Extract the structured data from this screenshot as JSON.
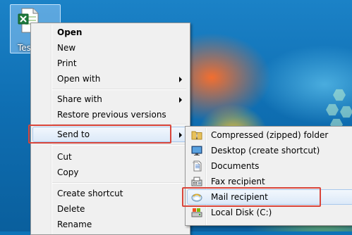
{
  "desktop": {
    "file": {
      "label": "Test"
    }
  },
  "context_menu": {
    "items": [
      {
        "label": "Open",
        "bold": true
      },
      {
        "label": "New"
      },
      {
        "label": "Print"
      },
      {
        "label": "Open with",
        "submenu": true
      },
      {
        "label": "Share with",
        "submenu": true
      },
      {
        "label": "Restore previous versions"
      },
      {
        "label": "Send to",
        "submenu": true,
        "highlighted": true
      },
      {
        "label": "Cut"
      },
      {
        "label": "Copy"
      },
      {
        "label": "Create shortcut"
      },
      {
        "label": "Delete"
      },
      {
        "label": "Rename"
      }
    ]
  },
  "send_to_menu": {
    "items": [
      {
        "label": "Compressed (zipped) folder",
        "icon": "zip-folder-icon"
      },
      {
        "label": "Desktop (create shortcut)",
        "icon": "desktop-icon"
      },
      {
        "label": "Documents",
        "icon": "documents-icon"
      },
      {
        "label": "Fax recipient",
        "icon": "fax-icon"
      },
      {
        "label": "Mail recipient",
        "icon": "mail-icon",
        "highlighted": true
      },
      {
        "label": "Local Disk (C:)",
        "icon": "local-disk-icon"
      }
    ]
  },
  "colors": {
    "annotation_red": "#d9453a",
    "menu_bg": "#f0f0f0",
    "highlight_border": "#a8c8ec"
  }
}
